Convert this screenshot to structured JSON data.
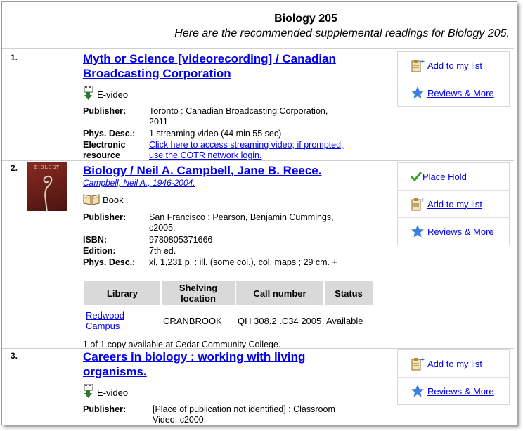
{
  "header": {
    "title": "Biology 205",
    "subtitle": "Here are the recommended supplemental readings for Biology 205."
  },
  "actions": {
    "add_to_list": "Add to my list",
    "reviews": " Reviews & More",
    "place_hold": "Place Hold"
  },
  "records": [
    {
      "number": "1.",
      "title_line1": "Myth or Science [videorecording] / Canadian",
      "title_line2": "Broadcasting Corporation",
      "format": "E-video",
      "publisher_label": "Publisher:",
      "publisher_1": "Toronto : Canadian Broadcasting Corporation,",
      "publisher_2": "2011",
      "phys_label": "Phys. Desc.:",
      "phys": "1 streaming video (44 min 55 sec)",
      "eres_label_1": "Electronic",
      "eres_label_2": "resource",
      "eres_link_1": "Click here to access streaming video; if prompted,",
      "eres_link_2": "use the COTR network login."
    },
    {
      "number": "2.",
      "cover_text": "BIOLOGY",
      "title": "Biology / Neil A. Campbell, Jane B. Reece.",
      "author": "Campbell, Neil A., 1946-2004.",
      "format": "Book",
      "publisher_label": "Publisher:",
      "publisher_1": "San Francisco : Pearson, Benjamin Cummings,",
      "publisher_2": "c2005.",
      "isbn_label": "ISBN:",
      "isbn": "9780805371666",
      "edition_label": "Edition:",
      "edition": "7th ed.",
      "phys_label": "Phys. Desc.:",
      "phys": "xl, 1,231 p. : ill. (some col.), col. maps ; 29 cm. +",
      "holdings": {
        "headers": [
          "Library",
          "Shelving location",
          "Call number",
          "Status"
        ],
        "row": {
          "library": "Redwood Campus",
          "location": "CRANBROOK",
          "call": "QH 308.2 .C34 2005",
          "status": "Available"
        }
      },
      "availability": "1 of 1 copy available at Cedar Community College."
    },
    {
      "number": "3.",
      "title_line1": "Careers in biology : working with living",
      "title_line2": "organisms.",
      "format": "E-video",
      "publisher_label": "Publisher:",
      "publisher_1": "[Place of publication not identified] : Classroom",
      "publisher_2": "Video, c2000."
    }
  ],
  "icons": {
    "list": "clipboard-plus-icon",
    "reviews": "star-icon",
    "hold": "checkmark-icon",
    "evideo": "evideo-download-icon",
    "book": "open-book-icon"
  },
  "colors": {
    "link": "#0000ee",
    "header_bg": "#d9d9d9",
    "hold_check": "#3aa02a",
    "star": "#3b7de0"
  }
}
